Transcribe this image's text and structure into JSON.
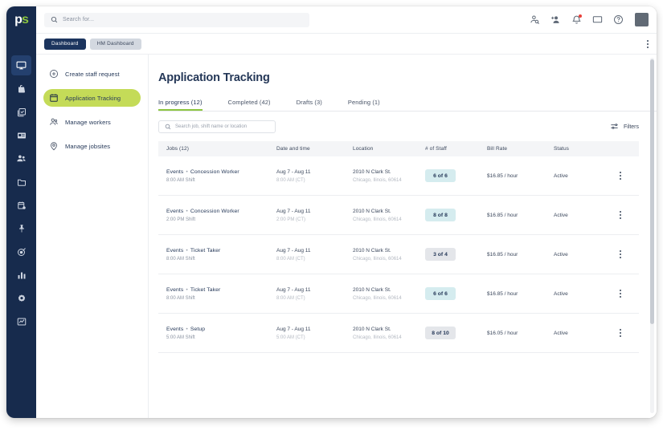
{
  "brand": {
    "logo_p": "p",
    "logo_s": "s",
    "accent_green": "#8cc63f",
    "active_nav_green": "#c4db58",
    "navy": "#172b4d"
  },
  "topbar": {
    "search_placeholder": "Search for...",
    "icons": [
      {
        "name": "user-search-icon"
      },
      {
        "name": "add-user-icon"
      },
      {
        "name": "notification-bell-icon",
        "has_dot": true
      },
      {
        "name": "monitor-icon"
      },
      {
        "name": "help-circle-icon"
      }
    ],
    "avatar_label": ""
  },
  "subbar": {
    "pills": [
      {
        "label": "Dashboard",
        "active": true
      },
      {
        "label": "HM Dashboard",
        "active": false
      }
    ],
    "overflow_icon": "kebab-menu-icon"
  },
  "rail": {
    "items": [
      {
        "name": "monitor-dashboard-icon",
        "active": true
      },
      {
        "name": "briefcase-icon",
        "active": false
      },
      {
        "name": "clipboard-check-icon",
        "active": false
      },
      {
        "name": "id-card-icon",
        "active": false
      },
      {
        "name": "people-icon",
        "active": false
      },
      {
        "name": "folder-icon",
        "active": false
      },
      {
        "name": "calendar-clock-icon",
        "active": false
      },
      {
        "name": "pin-icon",
        "active": false
      },
      {
        "name": "target-icon",
        "active": false
      },
      {
        "name": "bar-chart-icon",
        "active": false
      },
      {
        "name": "gear-icon",
        "active": false
      },
      {
        "name": "line-chart-icon",
        "active": false
      }
    ]
  },
  "nav": {
    "items": [
      {
        "label": "Create staff request",
        "icon": "plus-circle-icon",
        "active": false
      },
      {
        "label": "Application Tracking",
        "icon": "calendar-icon",
        "active": true
      },
      {
        "label": "Manage workers",
        "icon": "people-icon",
        "active": false
      },
      {
        "label": "Manage jobsites",
        "icon": "map-pin-icon",
        "active": false
      }
    ]
  },
  "main": {
    "page_title": "Application Tracking",
    "tabs": [
      {
        "label": "In progress (12)",
        "active": true
      },
      {
        "label": "Completed (42)",
        "active": false
      },
      {
        "label": "Drafts (3)",
        "active": false
      },
      {
        "label": "Pending (1)",
        "active": false
      }
    ],
    "table_search_placeholder": "Search job, shift name or location",
    "filters_label": "Filters",
    "filters_icon": "filter-sliders-icon",
    "columns": [
      "Jobs (12)",
      "Date and time",
      "Location",
      "# of Staff",
      "Bill Rate",
      "Status"
    ],
    "rows": [
      {
        "job_category": "Events",
        "job_role": "Concession Worker",
        "shift": "8:00 AM Shift",
        "date_range": "Aug 7 - Aug 11",
        "time": "8:00 AM (CT)",
        "address": "2010 N Clark St.",
        "city": "Chicago, Ilinois, 60614",
        "staff": "6 of 6",
        "staff_full": true,
        "bill_rate": "$16.85 / hour",
        "status": "Active"
      },
      {
        "job_category": "Events",
        "job_role": "Concession Worker",
        "shift": "2:00 PM Shift",
        "date_range": "Aug 7 - Aug 11",
        "time": "2:00 PM (CT)",
        "address": "2010 N Clark St.",
        "city": "Chicago, Ilinois, 60614",
        "staff": "8 of 8",
        "staff_full": true,
        "bill_rate": "$16.85 / hour",
        "status": "Active"
      },
      {
        "job_category": "Events",
        "job_role": "Ticket Taker",
        "shift": "8:00 AM Shift",
        "date_range": "Aug 7 - Aug 11",
        "time": "8:00 AM (CT)",
        "address": "2010 N Clark St.",
        "city": "Chicago, Ilinois, 60614",
        "staff": "3 of 4",
        "staff_full": false,
        "bill_rate": "$16.85 / hour",
        "status": "Active"
      },
      {
        "job_category": "Events",
        "job_role": "Ticket Taker",
        "shift": "8:00 AM Shift",
        "date_range": "Aug 7 - Aug 11",
        "time": "8:00 AM (CT)",
        "address": "2010 N Clark St.",
        "city": "Chicago, Ilinois, 60614",
        "staff": "6 of 6",
        "staff_full": true,
        "bill_rate": "$16.85 / hour",
        "status": "Active"
      },
      {
        "job_category": "Events",
        "job_role": "Setup",
        "shift": "5:00 AM Shift",
        "date_range": "Aug 7 - Aug 11",
        "time": "5:00 AM (CT)",
        "address": "2010 N Clark St.",
        "city": "Chicago, Ilinois, 60614",
        "staff": "8 of 10",
        "staff_full": false,
        "bill_rate": "$16.05 / hour",
        "status": "Active"
      }
    ],
    "row_menu_icon": "kebab-menu-icon",
    "separator_dot": "•"
  }
}
